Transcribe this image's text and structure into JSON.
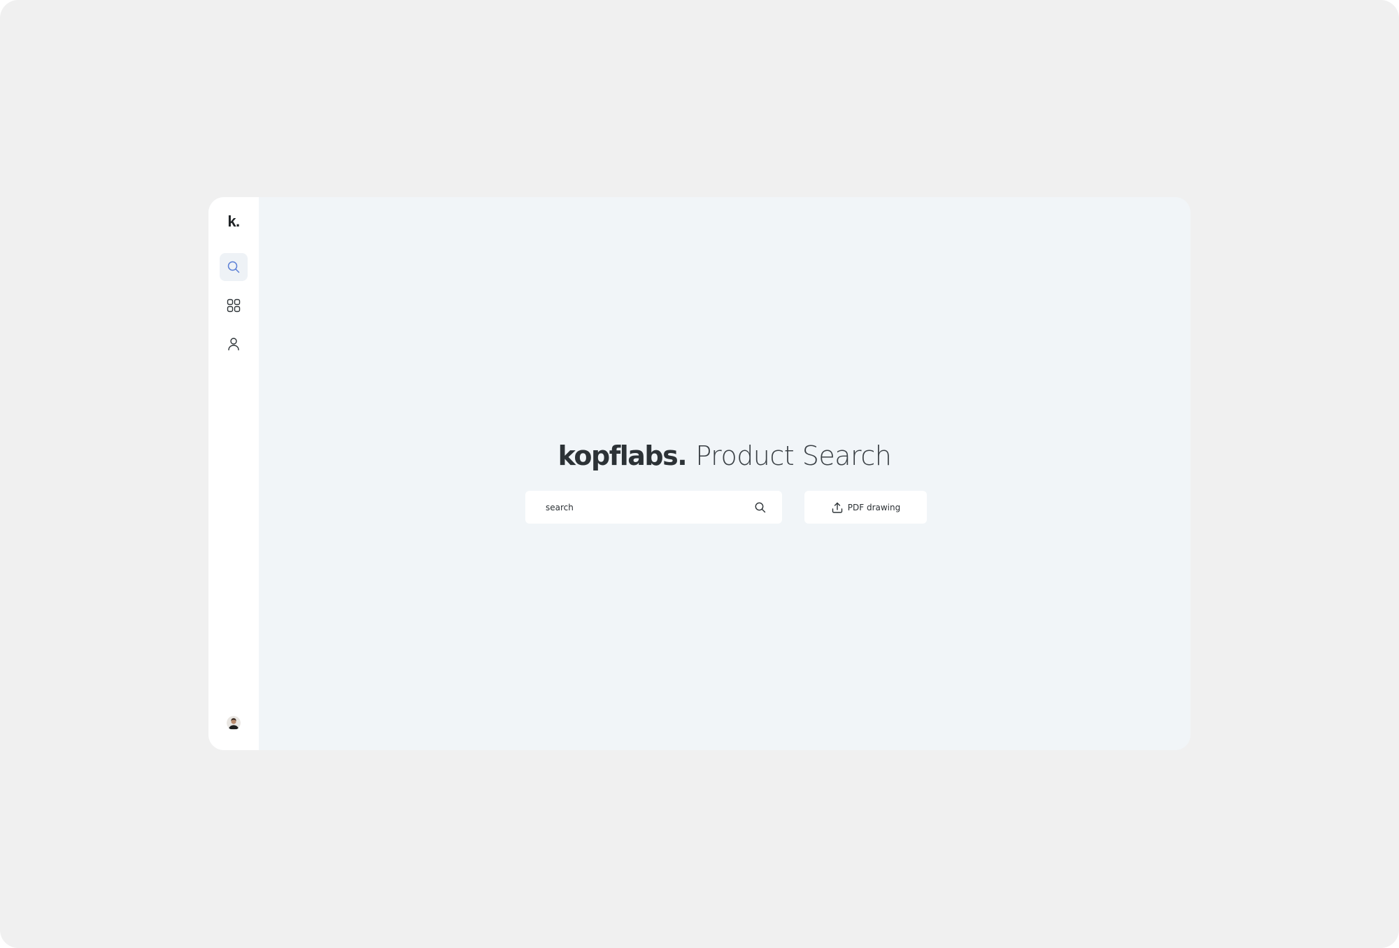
{
  "sidebar": {
    "logo": "k.",
    "items": [
      {
        "icon": "search-icon",
        "active": true
      },
      {
        "icon": "grid-icon",
        "active": false
      },
      {
        "icon": "user-icon",
        "active": false
      }
    ],
    "avatar": "avatar"
  },
  "main": {
    "title_brand": "kopflabs.",
    "title_rest": "Product Search",
    "search": {
      "placeholder": "search",
      "value": ""
    },
    "pdf_button_label": "PDF drawing"
  },
  "colors": {
    "page_background": "#f0f0f0",
    "sidebar_background": "#ffffff",
    "main_background": "#f1f5f8",
    "accent": "#5b7fd6",
    "text": "#2c3236"
  }
}
